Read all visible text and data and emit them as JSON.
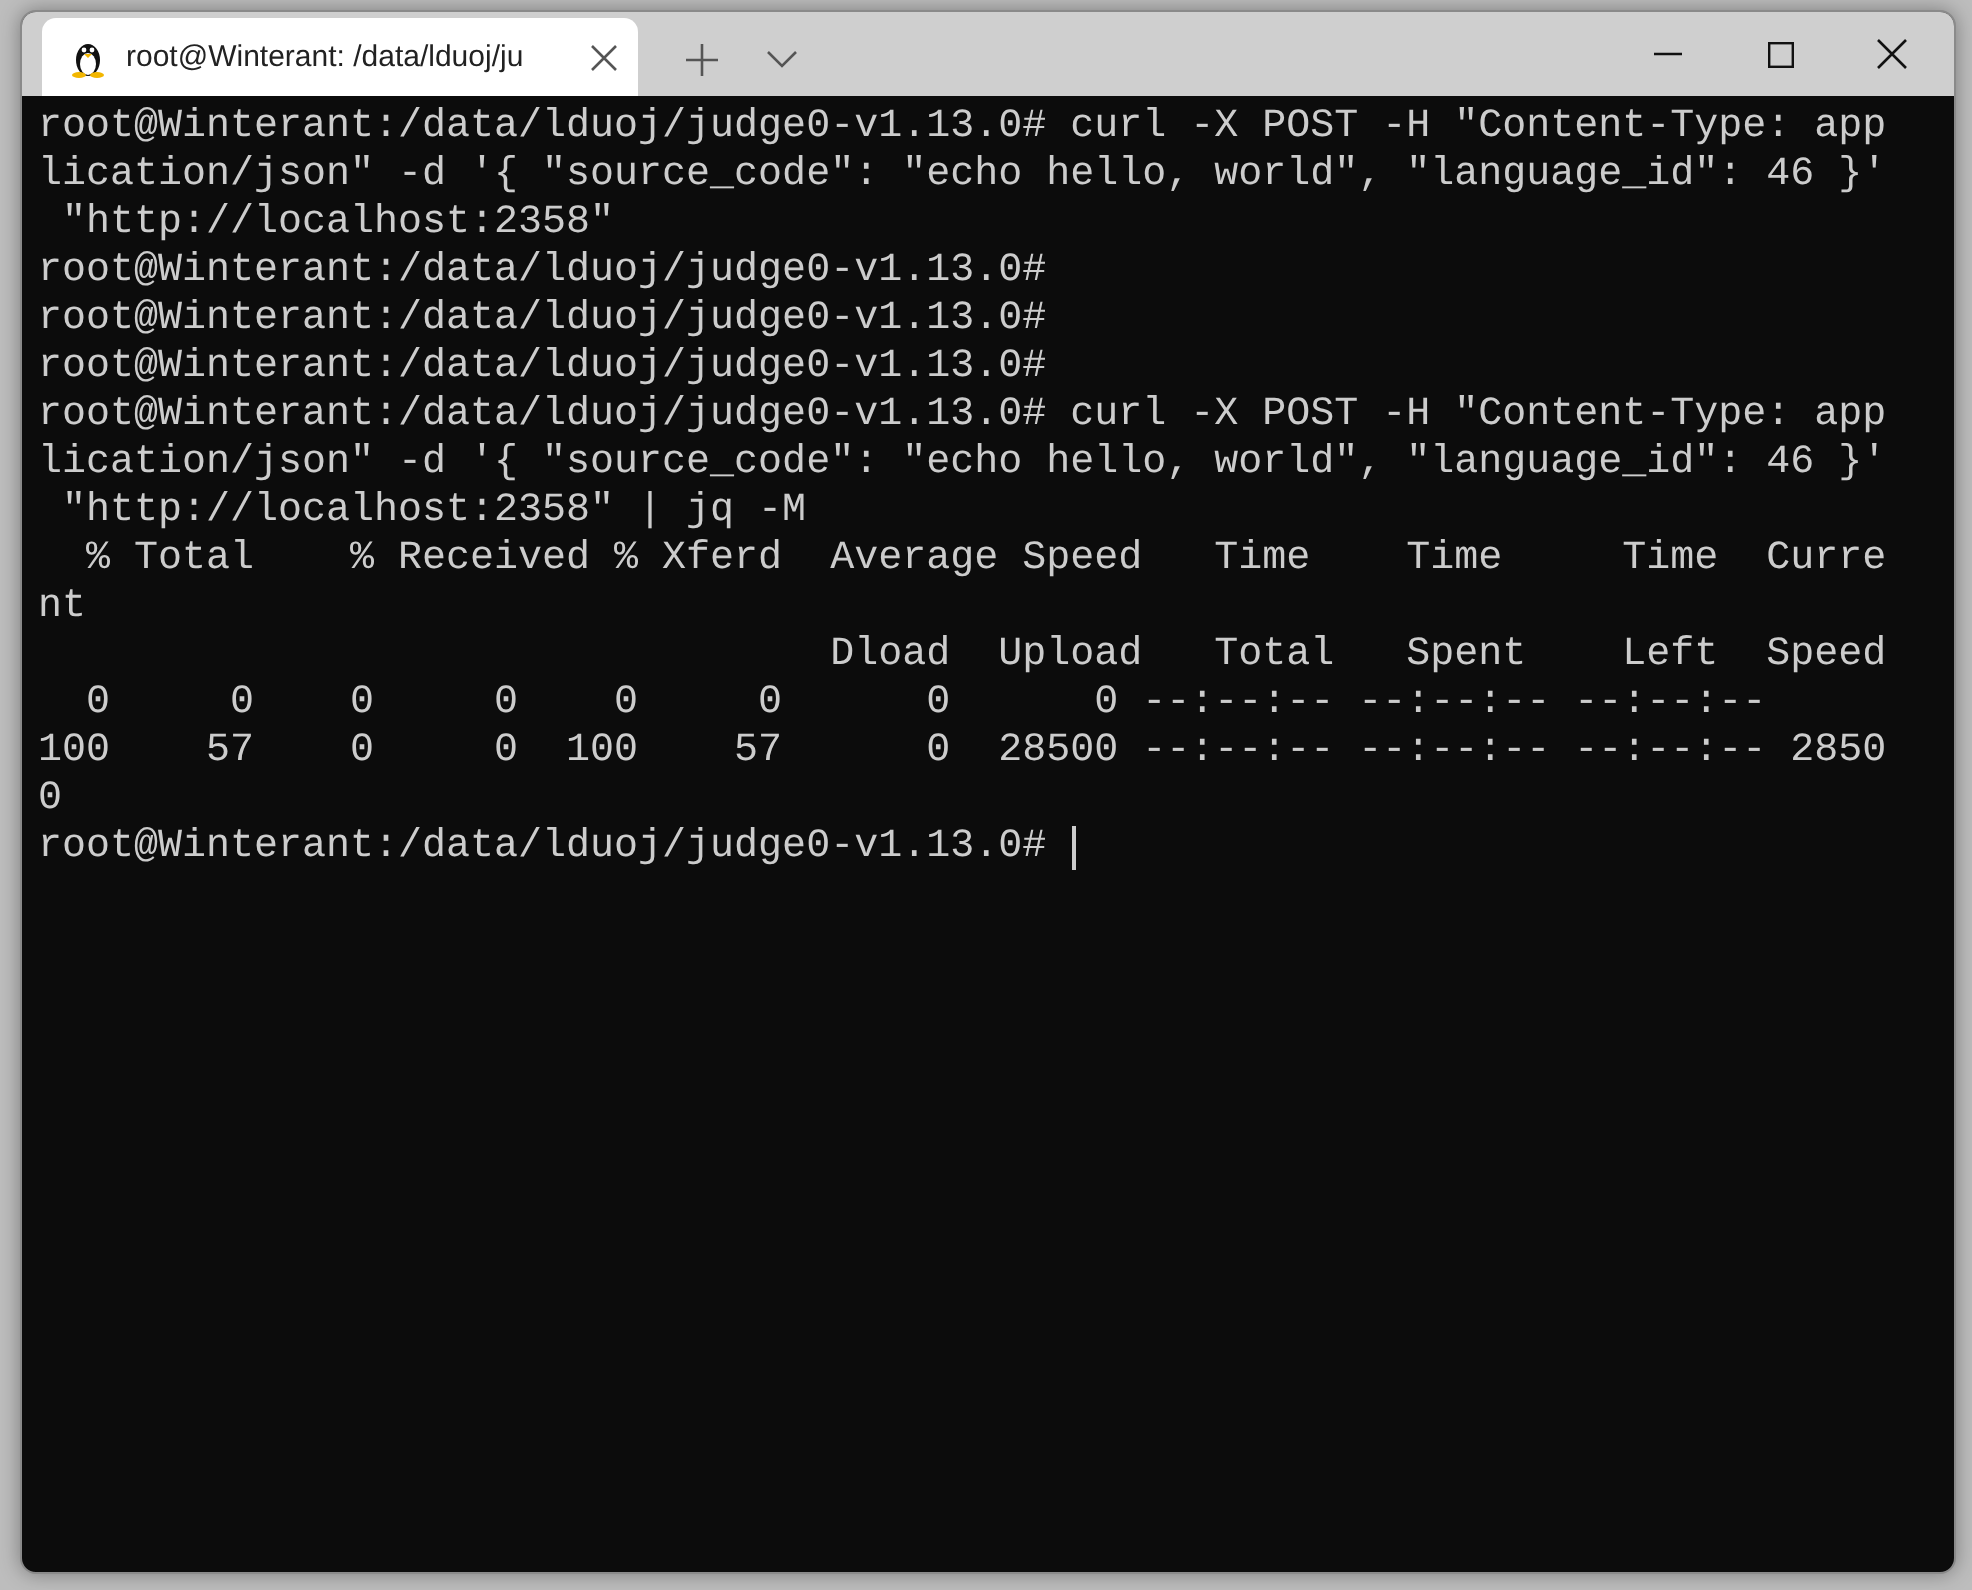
{
  "tab": {
    "title": "root@Winterant: /data/lduoj/ju",
    "selected": true
  },
  "terminal": {
    "lines": [
      {
        "text": "root@Winterant:/data/lduoj/judge0-v1.13.0# curl -X POST -H \"Content-Type: app",
        "cursor": false
      },
      {
        "text": "lication/json\" -d '{ \"source_code\": \"echo hello, world\", \"language_id\": 46 }'",
        "cursor": false
      },
      {
        "text": " \"http://localhost:2358\"",
        "cursor": false
      },
      {
        "text": "root@Winterant:/data/lduoj/judge0-v1.13.0#",
        "cursor": false
      },
      {
        "text": "root@Winterant:/data/lduoj/judge0-v1.13.0#",
        "cursor": false
      },
      {
        "text": "root@Winterant:/data/lduoj/judge0-v1.13.0#",
        "cursor": false
      },
      {
        "text": "root@Winterant:/data/lduoj/judge0-v1.13.0# curl -X POST -H \"Content-Type: app",
        "cursor": false
      },
      {
        "text": "lication/json\" -d '{ \"source_code\": \"echo hello, world\", \"language_id\": 46 }'",
        "cursor": false
      },
      {
        "text": " \"http://localhost:2358\" | jq -M",
        "cursor": false
      },
      {
        "text": "  % Total    % Received % Xferd  Average Speed   Time    Time     Time  Curre",
        "cursor": false
      },
      {
        "text": "nt",
        "cursor": false
      },
      {
        "text": "                                 Dload  Upload   Total   Spent    Left  Speed",
        "cursor": false
      },
      {
        "text": "  0     0    0     0    0     0      0      0 --:--:-- --:--:-- --:--:--",
        "cursor": false
      },
      {
        "text": "100    57    0     0  100    57      0  28500 --:--:-- --:--:-- --:--:-- 2850",
        "cursor": false
      },
      {
        "text": "0",
        "cursor": false
      },
      {
        "text": "root@Winterant:/data/lduoj/judge0-v1.13.0#",
        "cursor": true
      }
    ]
  }
}
